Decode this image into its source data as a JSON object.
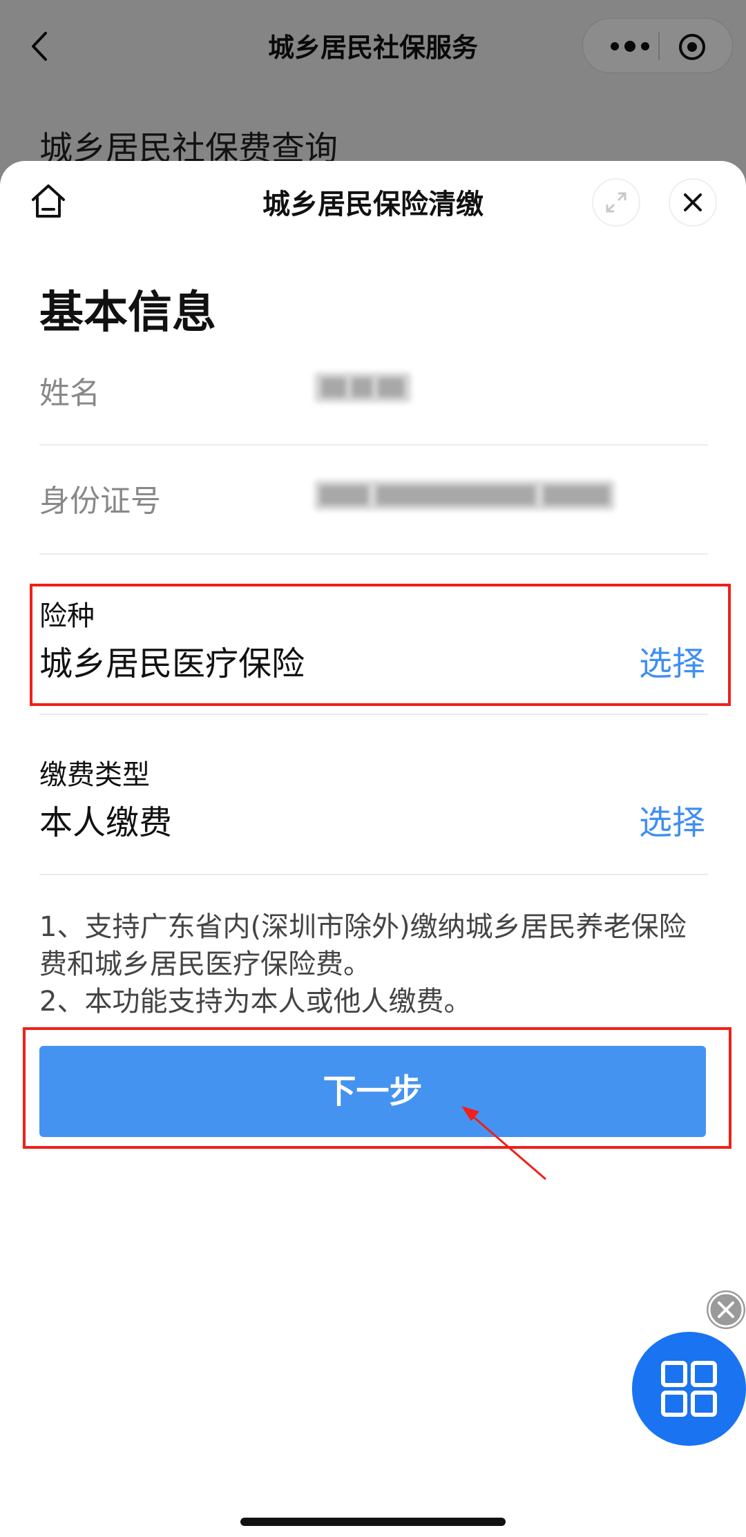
{
  "background_page": {
    "title": "城乡居民社保服务",
    "subtitle": "城乡居民社保费查询"
  },
  "sheet": {
    "title": "城乡居民保险清缴"
  },
  "section": {
    "title": "基本信息"
  },
  "basic_info": {
    "name_label": "姓名",
    "id_label": "身份证号"
  },
  "insurance_type": {
    "label": "险种",
    "value": "城乡居民医疗保险",
    "select_label": "选择"
  },
  "payment_type": {
    "label": "缴费类型",
    "value": "本人缴费",
    "select_label": "选择"
  },
  "notes": {
    "line1": "1、支持广东省内(深圳市除外)缴纳城乡居民养老保险费和城乡居民医疗保险费。",
    "line2": "2、本功能支持为本人或他人缴费。"
  },
  "next_button": {
    "label": "下一步"
  },
  "colors": {
    "accent": "#3f8ef3",
    "button": "#4593f0",
    "highlight_box": "#f0201a",
    "float_menu": "#1a73f0"
  }
}
